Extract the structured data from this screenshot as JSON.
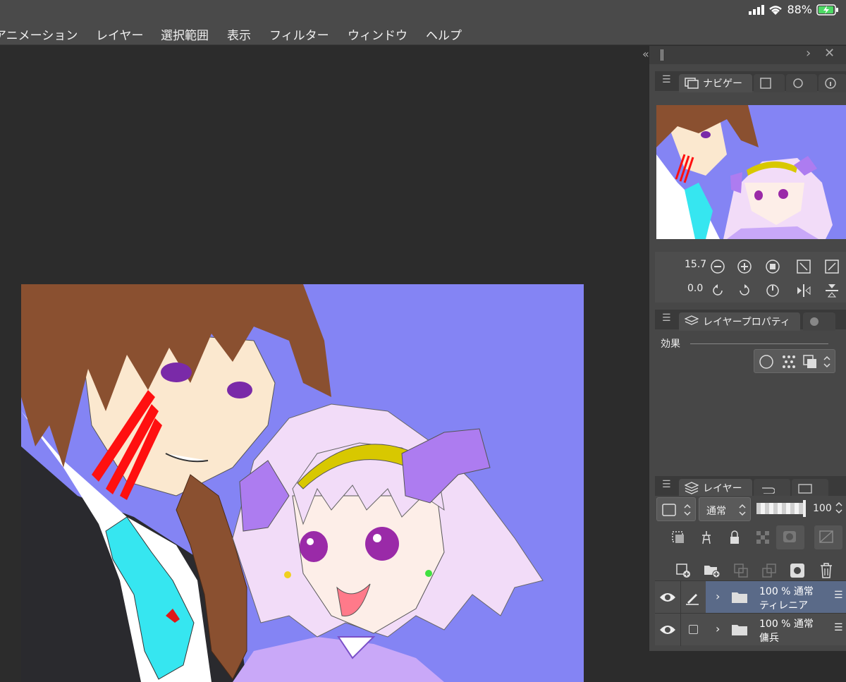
{
  "status": {
    "battery_percent": "88%"
  },
  "menu": {
    "items": [
      "アニメーション",
      "レイヤー",
      "選択範囲",
      "表示",
      "フィルター",
      "ウィンドウ",
      "ヘルプ"
    ]
  },
  "navigator": {
    "tab_label": "ナビゲー",
    "zoom_value": "15.7",
    "rotation_value": "0.0"
  },
  "layer_property": {
    "tab_label": "レイヤープロパティ",
    "effects_label": "効果"
  },
  "layers": {
    "tab_label": "レイヤー",
    "blend_mode": "通常",
    "opacity_value": "100",
    "rows": [
      {
        "opacity_blend": "100 % 通常",
        "name": "ティレニア"
      },
      {
        "opacity_blend": "100 % 通常",
        "name": "傭兵"
      }
    ]
  },
  "colors": {
    "accent": "#5a6a88",
    "canvas_bg": "#8484f4"
  }
}
